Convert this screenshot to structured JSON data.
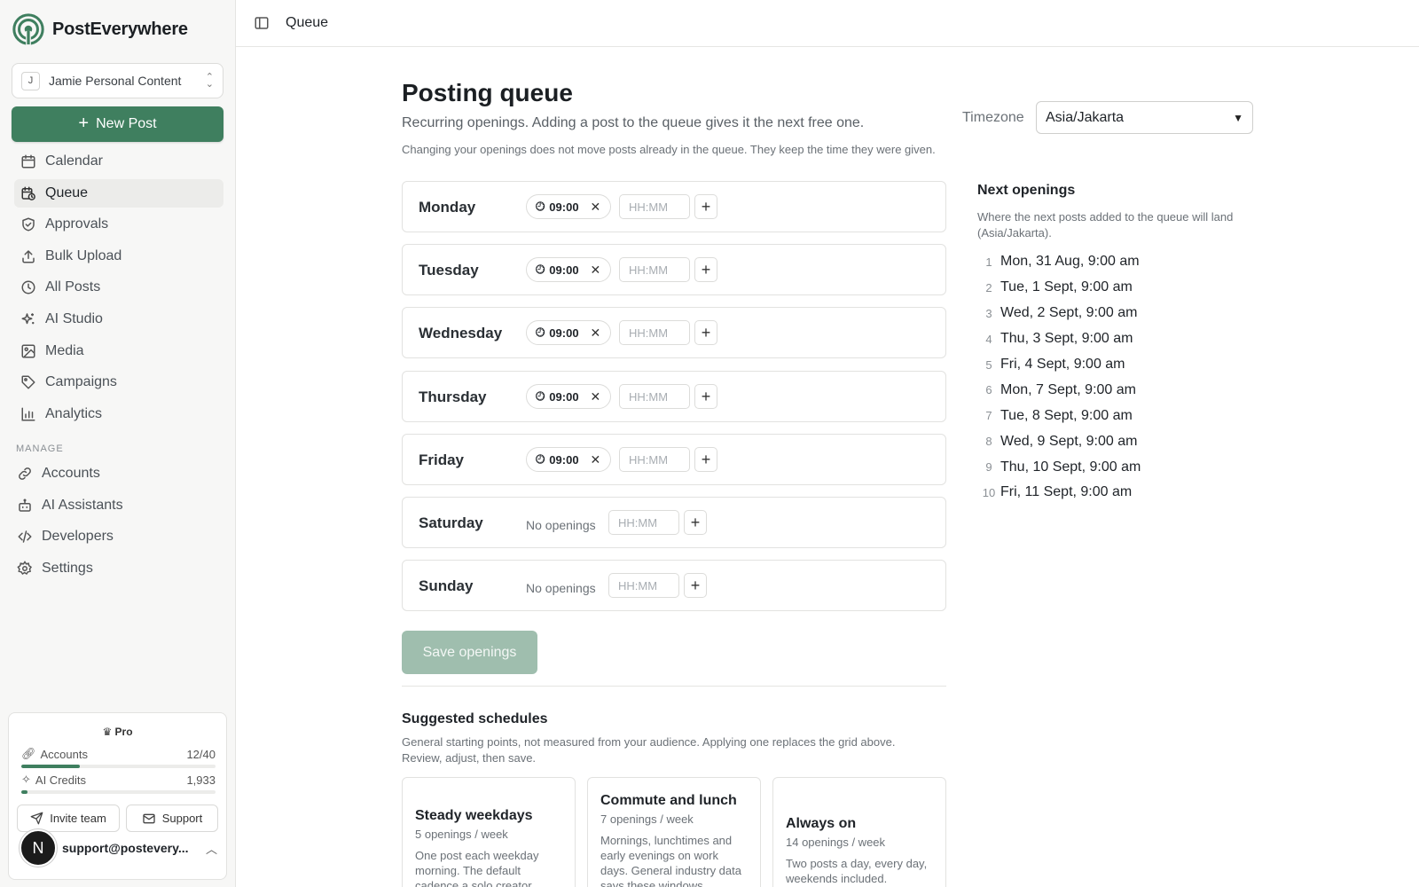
{
  "brand": {
    "name": "PostEverywhere"
  },
  "workspace": {
    "initial": "J",
    "name": "Jamie Personal Content"
  },
  "new_post_label": "New Post",
  "nav": [
    {
      "label": "Calendar",
      "icon": "calendar-icon",
      "active": false
    },
    {
      "label": "Queue",
      "icon": "queue-icon",
      "active": true
    },
    {
      "label": "Approvals",
      "icon": "shield-check-icon",
      "active": false
    },
    {
      "label": "Bulk Upload",
      "icon": "upload-icon",
      "active": false
    },
    {
      "label": "All Posts",
      "icon": "clock-icon",
      "active": false
    },
    {
      "label": "AI Studio",
      "icon": "sparkles-icon",
      "active": false
    },
    {
      "label": "Media",
      "icon": "image-icon",
      "active": false
    },
    {
      "label": "Campaigns",
      "icon": "tag-icon",
      "active": false
    },
    {
      "label": "Analytics",
      "icon": "bar-chart-icon",
      "active": false
    }
  ],
  "manage": {
    "label": "MANAGE",
    "items": [
      {
        "label": "Accounts",
        "icon": "link-icon"
      },
      {
        "label": "AI Assistants",
        "icon": "bot-icon"
      },
      {
        "label": "Developers",
        "icon": "code-icon"
      },
      {
        "label": "Settings",
        "icon": "gear-icon"
      }
    ]
  },
  "plan": {
    "badge": "Pro",
    "accounts": {
      "label": "Accounts",
      "value": "12/40",
      "fraction": 0.3
    },
    "credits": {
      "label": "AI Credits",
      "value": "1,933",
      "fraction": 0.03
    },
    "invite_label": "Invite team",
    "support_label": "Support",
    "user_initial": "N",
    "user_email": "support@postevery..."
  },
  "topbar": {
    "title": "Queue"
  },
  "page": {
    "title": "Posting queue",
    "subtitle": "Recurring openings. Adding a post to the queue gives it the next free one.",
    "note": "Changing your openings does not move posts already in the queue. They keep the time they were given.",
    "timezone_label": "Timezone",
    "timezone_value": "Asia/Jakarta"
  },
  "days": [
    {
      "name": "Monday",
      "slots": [
        "09:00"
      ],
      "placeholder": "HH:MM"
    },
    {
      "name": "Tuesday",
      "slots": [
        "09:00"
      ],
      "placeholder": "HH:MM"
    },
    {
      "name": "Wednesday",
      "slots": [
        "09:00"
      ],
      "placeholder": "HH:MM"
    },
    {
      "name": "Thursday",
      "slots": [
        "09:00"
      ],
      "placeholder": "HH:MM"
    },
    {
      "name": "Friday",
      "slots": [
        "09:00"
      ],
      "placeholder": "HH:MM"
    },
    {
      "name": "Saturday",
      "slots": [],
      "empty_label": "No openings",
      "placeholder": "HH:MM"
    },
    {
      "name": "Sunday",
      "slots": [],
      "empty_label": "No openings",
      "placeholder": "HH:MM"
    }
  ],
  "save_label": "Save openings",
  "suggested": {
    "title": "Suggested schedules",
    "description": "General starting points, not measured from your audience. Applying one replaces the grid above. Review, adjust, then save.",
    "cards": [
      {
        "title": "Steady weekdays",
        "count": "5 openings / week",
        "desc": "One post each weekday morning. The default cadence a solo creator"
      },
      {
        "title": "Commute and lunch",
        "count": "7 openings / week",
        "desc": "Mornings, lunchtimes and early evenings on work days. General industry data says these windows"
      },
      {
        "title": "Always on",
        "count": "14 openings / week",
        "desc": "Two posts a day, every day, weekends included."
      }
    ]
  },
  "next": {
    "title": "Next openings",
    "description": "Where the next posts added to the queue will land (Asia/Jakarta).",
    "items": [
      {
        "n": "1",
        "text": "Mon, 31 Aug, 9:00 am"
      },
      {
        "n": "2",
        "text": "Tue, 1 Sept, 9:00 am"
      },
      {
        "n": "3",
        "text": "Wed, 2 Sept, 9:00 am"
      },
      {
        "n": "4",
        "text": "Thu, 3 Sept, 9:00 am"
      },
      {
        "n": "5",
        "text": "Fri, 4 Sept, 9:00 am"
      },
      {
        "n": "6",
        "text": "Mon, 7 Sept, 9:00 am"
      },
      {
        "n": "7",
        "text": "Tue, 8 Sept, 9:00 am"
      },
      {
        "n": "8",
        "text": "Wed, 9 Sept, 9:00 am"
      },
      {
        "n": "9",
        "text": "Thu, 10 Sept, 9:00 am"
      },
      {
        "n": "10",
        "text": "Fri, 11 Sept, 9:00 am"
      }
    ]
  },
  "colors": {
    "accent": "#3f7f5f",
    "accent_disabled": "#9fbeae",
    "sidebar_bg": "#f7f7f6"
  }
}
